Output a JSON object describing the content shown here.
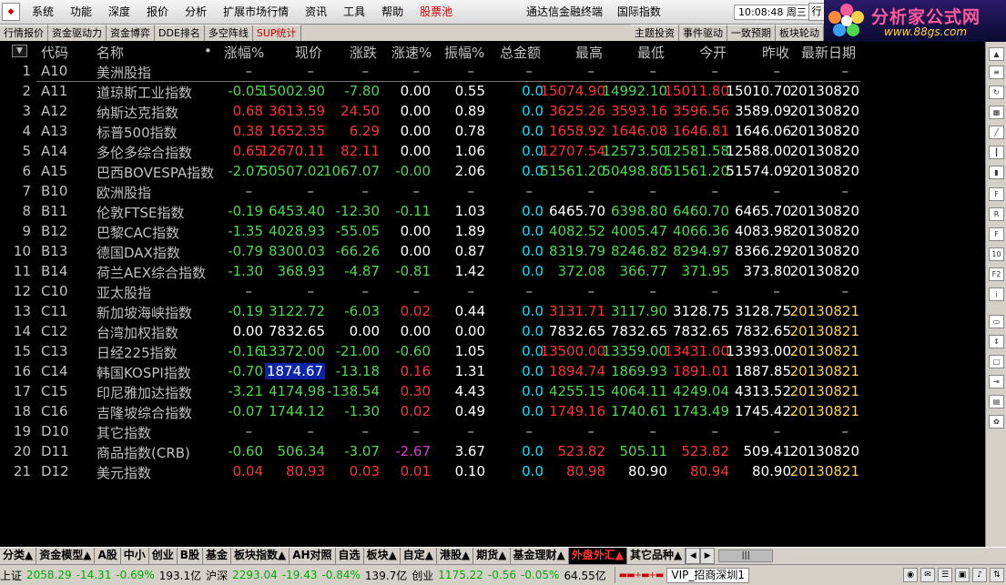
{
  "menu": {
    "items": [
      "系统",
      "功能",
      "深度",
      "报价",
      "分析",
      "扩展市场行情",
      "资讯",
      "工具",
      "帮助"
    ],
    "special": "股票池",
    "title_app": "通达信金融终端",
    "title_page": "国际指数",
    "clock": "10:08:48 周三",
    "trade_label": "行"
  },
  "brand": {
    "name": "分析家公式网",
    "url": "www.88gs.com"
  },
  "tabs": {
    "left": [
      "行情报价",
      "资金驱动力",
      "资金博弈",
      "DDE排名",
      "多空阵线",
      "SUP统计"
    ],
    "right": [
      "主题投资",
      "事件驱动",
      "一致预期",
      "板块轮动"
    ]
  },
  "table": {
    "headers": {
      "code": "代码",
      "name": "名称",
      "dot": "•",
      "pct": "涨幅%",
      "price": "现价",
      "chg": "涨跌",
      "speed": "涨速%",
      "amp": "振幅%",
      "amount": "总金额",
      "high": "最高",
      "low": "最低",
      "open": "今开",
      "prev": "昨收",
      "date": "最新日期"
    },
    "rows": [
      {
        "n": "1",
        "code": "A10",
        "name": "美洲股指",
        "pct": "–",
        "price": "–",
        "chg": "–",
        "speed": "–",
        "amp": "–",
        "amount": "–",
        "high": "–",
        "low": "–",
        "open": "–",
        "prev": "–",
        "date": "–",
        "hdr": true
      },
      {
        "n": "2",
        "code": "A11",
        "name": "道琼斯工业指数",
        "pct": "-0.05",
        "price": "15002.90",
        "chg": "-7.80",
        "speed": "0.00",
        "amp": "0.55",
        "amount": "0.0",
        "high": "15074.90",
        "low": "14992.10",
        "open": "15011.80",
        "prev": "15010.70",
        "date": "20130820",
        "dir": "g",
        "sp": "w",
        "hi": "r",
        "lo": "g",
        "op": "r",
        "dt": "w"
      },
      {
        "n": "3",
        "code": "A12",
        "name": "纳斯达克指数",
        "pct": "0.68",
        "price": "3613.59",
        "chg": "24.50",
        "speed": "0.00",
        "amp": "0.89",
        "amount": "0.0",
        "high": "3625.26",
        "low": "3593.16",
        "open": "3596.56",
        "prev": "3589.09",
        "date": "20130820",
        "dir": "r",
        "sp": "w",
        "hi": "r",
        "lo": "r",
        "op": "r",
        "dt": "w"
      },
      {
        "n": "4",
        "code": "A13",
        "name": "标普500指数",
        "pct": "0.38",
        "price": "1652.35",
        "chg": "6.29",
        "speed": "0.00",
        "amp": "0.78",
        "amount": "0.0",
        "high": "1658.92",
        "low": "1646.08",
        "open": "1646.81",
        "prev": "1646.06",
        "date": "20130820",
        "dir": "r",
        "sp": "w",
        "hi": "r",
        "lo": "r",
        "op": "r",
        "dt": "w"
      },
      {
        "n": "5",
        "code": "A14",
        "name": "多伦多综合指数",
        "pct": "0.65",
        "price": "12670.11",
        "chg": "82.11",
        "speed": "0.00",
        "amp": "1.06",
        "amount": "0.0",
        "high": "12707.54",
        "low": "12573.50",
        "open": "12581.58",
        "prev": "12588.00",
        "date": "20130820",
        "dir": "r",
        "sp": "w",
        "hi": "r",
        "lo": "g",
        "op": "g",
        "dt": "w"
      },
      {
        "n": "6",
        "code": "A15",
        "name": "巴西BOVESPA指数",
        "pct": "-2.07",
        "price": "50507.02",
        "chg": "1067.07",
        "speed": "-0.00",
        "amp": "2.06",
        "amount": "0.0",
        "high": "51561.20",
        "low": "50498.80",
        "open": "51561.20",
        "prev": "51574.09",
        "date": "20130820",
        "dir": "g",
        "sp": "g",
        "hi": "g",
        "lo": "g",
        "op": "g",
        "dt": "w"
      },
      {
        "n": "7",
        "code": "B10",
        "name": "欧洲股指",
        "pct": "–",
        "price": "–",
        "chg": "–",
        "speed": "–",
        "amp": "–",
        "amount": "–",
        "high": "–",
        "low": "–",
        "open": "–",
        "prev": "–",
        "date": "–",
        "hdr": true
      },
      {
        "n": "8",
        "code": "B11",
        "name": "伦敦FTSE指数",
        "pct": "-0.19",
        "price": "6453.40",
        "chg": "-12.30",
        "speed": "-0.11",
        "amp": "1.03",
        "amount": "0.0",
        "high": "6465.70",
        "low": "6398.80",
        "open": "6460.70",
        "prev": "6465.70",
        "date": "20130820",
        "dir": "g",
        "sp": "g",
        "hi": "w",
        "lo": "g",
        "op": "g",
        "dt": "w"
      },
      {
        "n": "9",
        "code": "B12",
        "name": "巴黎CAC指数",
        "pct": "-1.35",
        "price": "4028.93",
        "chg": "-55.05",
        "speed": "0.00",
        "amp": "1.89",
        "amount": "0.0",
        "high": "4082.52",
        "low": "4005.47",
        "open": "4066.36",
        "prev": "4083.98",
        "date": "20130820",
        "dir": "g",
        "sp": "w",
        "hi": "g",
        "lo": "g",
        "op": "g",
        "dt": "w"
      },
      {
        "n": "10",
        "code": "B13",
        "name": "德国DAX指数",
        "pct": "-0.79",
        "price": "8300.03",
        "chg": "-66.26",
        "speed": "0.00",
        "amp": "0.87",
        "amount": "0.0",
        "high": "8319.79",
        "low": "8246.82",
        "open": "8294.97",
        "prev": "8366.29",
        "date": "20130820",
        "dir": "g",
        "sp": "w",
        "hi": "g",
        "lo": "g",
        "op": "g",
        "dt": "w"
      },
      {
        "n": "11",
        "code": "B14",
        "name": "荷兰AEX综合指数",
        "pct": "-1.30",
        "price": "368.93",
        "chg": "-4.87",
        "speed": "-0.81",
        "amp": "1.42",
        "amount": "0.0",
        "high": "372.08",
        "low": "366.77",
        "open": "371.95",
        "prev": "373.80",
        "date": "20130820",
        "dir": "g",
        "sp": "g",
        "hi": "g",
        "lo": "g",
        "op": "g",
        "dt": "w"
      },
      {
        "n": "12",
        "code": "C10",
        "name": "亚太股指",
        "pct": "–",
        "price": "–",
        "chg": "–",
        "speed": "–",
        "amp": "–",
        "amount": "–",
        "high": "–",
        "low": "–",
        "open": "–",
        "prev": "–",
        "date": "–",
        "hdr": true
      },
      {
        "n": "13",
        "code": "C11",
        "name": "新加坡海峡指数",
        "pct": "-0.19",
        "price": "3122.72",
        "chg": "-6.03",
        "speed": "0.02",
        "amp": "0.44",
        "amount": "0.0",
        "high": "3131.71",
        "low": "3117.90",
        "open": "3128.75",
        "prev": "3128.75",
        "date": "20130821",
        "dir": "g",
        "sp": "r",
        "hi": "r",
        "lo": "g",
        "op": "w",
        "dt": "y"
      },
      {
        "n": "14",
        "code": "C12",
        "name": "台湾加权指数",
        "pct": "0.00",
        "price": "7832.65",
        "chg": "0.00",
        "speed": "0.00",
        "amp": "0.00",
        "amount": "0.0",
        "high": "7832.65",
        "low": "7832.65",
        "open": "7832.65",
        "prev": "7832.65",
        "date": "20130821",
        "dir": "w",
        "sp": "w",
        "hi": "w",
        "lo": "w",
        "op": "w",
        "dt": "y"
      },
      {
        "n": "15",
        "code": "C13",
        "name": "日经225指数",
        "pct": "-0.16",
        "price": "13372.00",
        "chg": "-21.00",
        "speed": "-0.60",
        "amp": "1.05",
        "amount": "0.0",
        "high": "13500.00",
        "low": "13359.00",
        "open": "13431.00",
        "prev": "13393.00",
        "date": "20130821",
        "dir": "g",
        "sp": "g",
        "hi": "r",
        "lo": "g",
        "op": "r",
        "dt": "y"
      },
      {
        "n": "16",
        "code": "C14",
        "name": "韩国KOSPI指数",
        "pct": "-0.70",
        "price": "1874.67",
        "chg": "-13.18",
        "speed": "0.16",
        "amp": "1.31",
        "amount": "0.0",
        "high": "1894.74",
        "low": "1869.93",
        "open": "1891.01",
        "prev": "1887.85",
        "date": "20130821",
        "dir": "g",
        "sp": "r",
        "hi": "r",
        "lo": "g",
        "op": "r",
        "dt": "y",
        "sel": true
      },
      {
        "n": "17",
        "code": "C15",
        "name": "印尼雅加达指数",
        "pct": "-3.21",
        "price": "4174.98",
        "chg": "-138.54",
        "speed": "0.30",
        "amp": "4.43",
        "amount": "0.0",
        "high": "4255.15",
        "low": "4064.11",
        "open": "4249.04",
        "prev": "4313.52",
        "date": "20130821",
        "dir": "g",
        "sp": "r",
        "hi": "g",
        "lo": "g",
        "op": "g",
        "dt": "y"
      },
      {
        "n": "18",
        "code": "C16",
        "name": "吉隆坡综合指数",
        "pct": "-0.07",
        "price": "1744.12",
        "chg": "-1.30",
        "speed": "0.02",
        "amp": "0.49",
        "amount": "0.0",
        "high": "1749.16",
        "low": "1740.61",
        "open": "1743.49",
        "prev": "1745.42",
        "date": "20130821",
        "dir": "g",
        "sp": "r",
        "hi": "r",
        "lo": "g",
        "op": "g",
        "dt": "y"
      },
      {
        "n": "19",
        "code": "D10",
        "name": "其它指数",
        "pct": "–",
        "price": "–",
        "chg": "–",
        "speed": "–",
        "amp": "–",
        "amount": "–",
        "high": "–",
        "low": "–",
        "open": "–",
        "prev": "–",
        "date": "–",
        "hdr": true
      },
      {
        "n": "20",
        "code": "D11",
        "name": "商品指数(CRB)",
        "pct": "-0.60",
        "price": "506.34",
        "chg": "-3.07",
        "speed": "-2.67",
        "amp": "3.67",
        "amount": "0.0",
        "high": "523.82",
        "low": "505.11",
        "open": "523.82",
        "prev": "509.41",
        "date": "20130820",
        "dir": "g",
        "sp": "m",
        "hi": "r",
        "lo": "g",
        "op": "r",
        "dt": "w"
      },
      {
        "n": "21",
        "code": "D12",
        "name": "美元指数",
        "pct": "0.04",
        "price": "80.93",
        "chg": "0.03",
        "speed": "0.01",
        "amp": "0.10",
        "amount": "0.0",
        "high": "80.98",
        "low": "80.90",
        "open": "80.94",
        "prev": "80.90",
        "date": "20130821",
        "dir": "r",
        "sp": "r",
        "hi": "r",
        "lo": "w",
        "op": "r",
        "dt": "y"
      }
    ]
  },
  "bottom_tabs": [
    {
      "label": "分类▲"
    },
    {
      "label": "资金模型▲"
    },
    {
      "label": "A股"
    },
    {
      "label": "中小"
    },
    {
      "label": "创业"
    },
    {
      "label": "B股"
    },
    {
      "label": "基金"
    },
    {
      "label": "板块指数▲"
    },
    {
      "label": "AH对照"
    },
    {
      "label": "自选"
    },
    {
      "label": "板块▲"
    },
    {
      "label": "自定▲"
    },
    {
      "label": "港股▲"
    },
    {
      "label": "期货▲"
    },
    {
      "label": "基金理财▲"
    },
    {
      "label": "外盘外汇▲",
      "active": true
    },
    {
      "label": "其它品种▲"
    }
  ],
  "status": {
    "sh_label": "上证",
    "sh_val": "2058.29",
    "sh_chg": "-14.31",
    "sh_pct": "-0.69%",
    "sh_amt": "193.1亿",
    "sz_label": "沪深",
    "sz_val": "2293.04",
    "sz_chg": "-19.43",
    "sz_pct": "-0.84%",
    "sz_amt": "139.7亿",
    "cy_label": "创业",
    "cy_val": "1175.22",
    "cy_chg": "-0.56",
    "cy_pct": "-0.05%",
    "cy_amt": "64.55亿",
    "vip": "VIP_招商深圳1"
  },
  "colors": {
    "up": "#ff3333",
    "down": "#4cd94c",
    "flat": "#ffffff",
    "amount": "#00e5ff",
    "date_new": "#ffd24a"
  }
}
